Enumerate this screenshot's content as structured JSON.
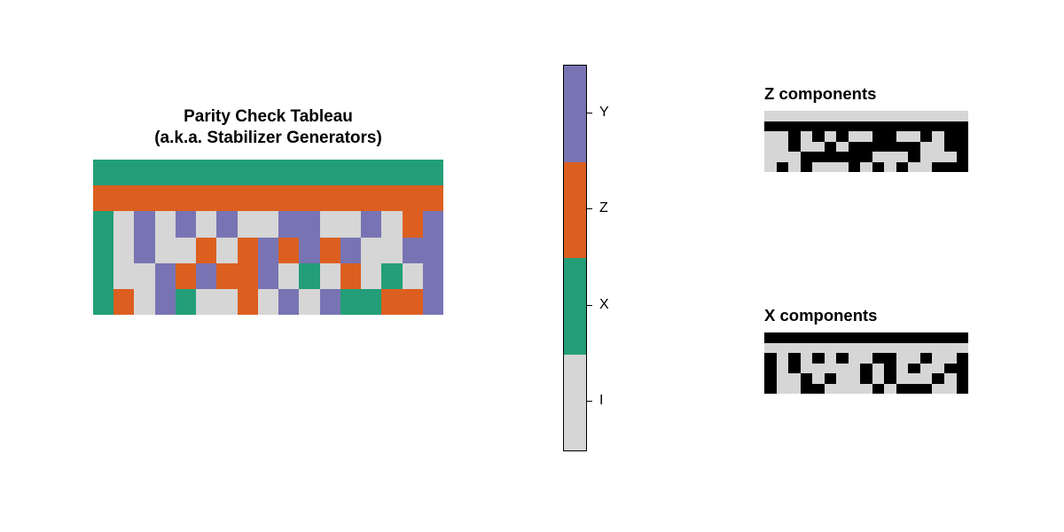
{
  "title_line1": "Parity Check Tableau",
  "title_line2": "(a.k.a. Stabilizer Generators)",
  "legend": {
    "labels": [
      "Y",
      "Z",
      "X",
      "I"
    ],
    "colors": [
      "#7874b3",
      "#dc5f20",
      "#239e78",
      "#d6d6d6"
    ]
  },
  "z_title": "Z components",
  "x_title": "X components",
  "chart_data": {
    "type": "heatmap",
    "tableau": {
      "rows": 6,
      "cols": 17,
      "palette": {
        "I": "#d6d6d6",
        "X": "#239e78",
        "Z": "#dc5f20",
        "Y": "#7874b3"
      },
      "values": [
        [
          "X",
          "X",
          "X",
          "X",
          "X",
          "X",
          "X",
          "X",
          "X",
          "X",
          "X",
          "X",
          "X",
          "X",
          "X",
          "X",
          "X"
        ],
        [
          "Z",
          "Z",
          "Z",
          "Z",
          "Z",
          "Z",
          "Z",
          "Z",
          "Z",
          "Z",
          "Z",
          "Z",
          "Z",
          "Z",
          "Z",
          "Z",
          "Z"
        ],
        [
          "X",
          "I",
          "Y",
          "I",
          "Y",
          "I",
          "Y",
          "I",
          "I",
          "Y",
          "Y",
          "I",
          "I",
          "Y",
          "I",
          "Z",
          "Y"
        ],
        [
          "X",
          "I",
          "Y",
          "I",
          "I",
          "Z",
          "I",
          "Z",
          "Y",
          "Z",
          "Y",
          "Z",
          "Y",
          "I",
          "I",
          "Y",
          "Y"
        ],
        [
          "X",
          "I",
          "I",
          "Y",
          "Z",
          "Y",
          "Z",
          "Z",
          "Y",
          "I",
          "X",
          "I",
          "Z",
          "I",
          "X",
          "I",
          "Y"
        ],
        [
          "X",
          "Z",
          "I",
          "Y",
          "X",
          "I",
          "I",
          "Z",
          "I",
          "Y",
          "I",
          "Y",
          "X",
          "X",
          "Z",
          "Z",
          "Y"
        ]
      ]
    },
    "z_components": {
      "rows": 6,
      "cols": 17,
      "values": [
        [
          0,
          0,
          0,
          0,
          0,
          0,
          0,
          0,
          0,
          0,
          0,
          0,
          0,
          0,
          0,
          0,
          0
        ],
        [
          1,
          1,
          1,
          1,
          1,
          1,
          1,
          1,
          1,
          1,
          1,
          1,
          1,
          1,
          1,
          1,
          1
        ],
        [
          0,
          0,
          1,
          0,
          1,
          0,
          1,
          0,
          0,
          1,
          1,
          0,
          0,
          1,
          0,
          1,
          1
        ],
        [
          0,
          0,
          1,
          0,
          0,
          1,
          0,
          1,
          1,
          1,
          1,
          1,
          1,
          0,
          0,
          1,
          1
        ],
        [
          0,
          0,
          0,
          1,
          1,
          1,
          1,
          1,
          1,
          0,
          0,
          0,
          1,
          0,
          0,
          0,
          1
        ],
        [
          0,
          1,
          0,
          1,
          0,
          0,
          0,
          1,
          0,
          1,
          0,
          1,
          0,
          0,
          1,
          1,
          1
        ]
      ]
    },
    "x_components": {
      "rows": 6,
      "cols": 17,
      "values": [
        [
          1,
          1,
          1,
          1,
          1,
          1,
          1,
          1,
          1,
          1,
          1,
          1,
          1,
          1,
          1,
          1,
          1
        ],
        [
          0,
          0,
          0,
          0,
          0,
          0,
          0,
          0,
          0,
          0,
          0,
          0,
          0,
          0,
          0,
          0,
          0
        ],
        [
          1,
          0,
          1,
          0,
          1,
          0,
          1,
          0,
          0,
          1,
          1,
          0,
          0,
          1,
          0,
          0,
          1
        ],
        [
          1,
          0,
          1,
          0,
          0,
          0,
          0,
          0,
          1,
          0,
          1,
          0,
          1,
          0,
          0,
          1,
          1
        ],
        [
          1,
          0,
          0,
          1,
          0,
          1,
          0,
          0,
          1,
          0,
          1,
          0,
          0,
          0,
          1,
          0,
          1
        ],
        [
          1,
          0,
          0,
          1,
          1,
          0,
          0,
          0,
          0,
          1,
          0,
          1,
          1,
          1,
          0,
          0,
          1
        ]
      ]
    }
  }
}
